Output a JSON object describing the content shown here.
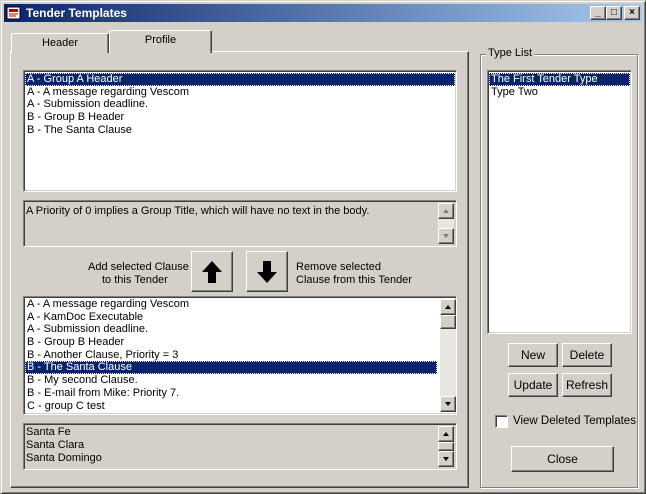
{
  "window": {
    "title": "Tender Templates"
  },
  "titlebar_buttons": {
    "minimize": "_",
    "maximize": "□",
    "close": "×"
  },
  "tabs": [
    {
      "label": "Header"
    },
    {
      "label": "Profile"
    }
  ],
  "profile": {
    "selected_clauses": [
      "A - Group A Header",
      "A - A message regarding Vescom",
      "A - Submission deadline.",
      "B - Group B Header",
      "B - The Santa Clause"
    ],
    "selected_clauses_selected_index": 0,
    "description": "A Priority of 0 implies a Group Title, which will have no text in the body.",
    "add_label_1": "Add selected Clause",
    "add_label_2": "to this Tender",
    "remove_label_1": "Remove selected",
    "remove_label_2": "Clause from this Tender",
    "available_clauses": [
      "A - A message regarding Vescom",
      "A - KamDoc Executable",
      "A - Submission deadline.",
      "B - Group B Header",
      "B - Another Clause, Priority = 3",
      "B - The Santa Clause",
      "B - My second Clause.",
      "B - E-mail from Mike: Priority 7.",
      "C - group C test"
    ],
    "available_clauses_selected_index": 5,
    "bottom_text_lines": [
      "Santa Fe",
      "Santa Clara",
      "Santa Domingo"
    ]
  },
  "type_list": {
    "title": "Type List",
    "items": [
      "The First Tender Type",
      "Type Two"
    ],
    "selected_index": 0
  },
  "buttons": {
    "new": "New",
    "delete": "Delete",
    "update": "Update",
    "refresh": "Refresh",
    "close": "Close"
  },
  "view_deleted": {
    "label": "View Deleted Templates",
    "checked": false
  },
  "colors": {
    "face": "#d4d0c8",
    "selection": "#0a246a",
    "title_start": "#0a246a",
    "title_end": "#a6caf0"
  }
}
